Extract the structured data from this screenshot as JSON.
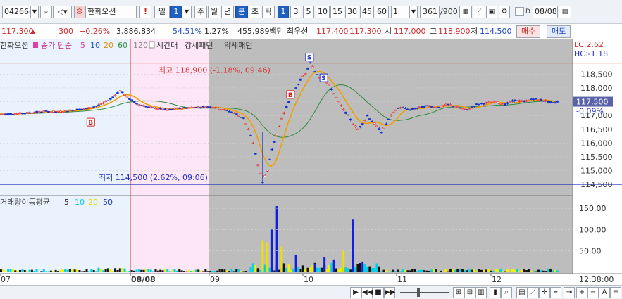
{
  "toolbar": {
    "code": "042660",
    "name": "한화오션",
    "badge": "증",
    "alert": "!",
    "period_day": "일",
    "period_count": "1",
    "periods": [
      "주",
      "월",
      "년",
      "분",
      "초",
      "틱"
    ],
    "minute_steps": [
      "1",
      "3",
      "5",
      "10",
      "15",
      "30",
      "45",
      "60"
    ],
    "count_value": "1",
    "range_value": "361",
    "range_total": "/900",
    "date_flag": "D",
    "date_value": "08/08"
  },
  "info": {
    "price": "117,300",
    "change": "300",
    "change_pct": "+0.26%",
    "volume": "3,886,834",
    "ratio": "54.51%",
    "rate": "1.27%",
    "amount": "455,989백만",
    "ask_label": "최우선",
    "ask": "117,400",
    "bid": "117,300",
    "open_label": "시",
    "open": "117,000",
    "high_label": "고",
    "high": "118,900",
    "low_label": "저",
    "low": "114,500",
    "buy": "매수",
    "sell": "매도"
  },
  "chart_labels": {
    "legend_name": "한화오션",
    "legend_type": "종가 단순",
    "ma": [
      "5",
      "10",
      "20",
      "60",
      "120"
    ],
    "pattern_time": "시간대",
    "pattern_strong": "강세패턴",
    "pattern_weak": "약세패턴",
    "high_marker": "최고 118,900 (-1.18%, 09:46)",
    "low_marker": "최저 114,500 (2.62%, 09:06)",
    "lc": "LC:2.62",
    "hc": "HC:-1.18",
    "current_price": "117,500",
    "current_pct": "-0.09%",
    "volume_legend": "거래량이동평균",
    "volume_ma": [
      "5",
      "10",
      "20",
      "50"
    ],
    "signal_s": "S",
    "signal_b": "B",
    "time_right": "12:38:00"
  },
  "chart_data": {
    "type": "candlestick",
    "price_axis": {
      "ticks": [
        118500,
        118000,
        117500,
        117000,
        116500,
        116000,
        115500,
        115000,
        114500
      ],
      "range": [
        114300,
        119300
      ]
    },
    "volume_axis": {
      "ticks": [
        "150,00",
        "100,00",
        "50,00"
      ],
      "range": [
        0,
        170
      ]
    },
    "x_ticks": [
      "07",
      "08/08",
      "09",
      "10",
      "11",
      "12"
    ],
    "high_line": 118900,
    "low_line": 114500,
    "current": 117500,
    "price_path": [
      [
        0,
        117050
      ],
      [
        3,
        117070
      ],
      [
        6,
        117100
      ],
      [
        9,
        117150
      ],
      [
        12,
        117130
      ],
      [
        15,
        117200
      ],
      [
        18,
        117250
      ],
      [
        21,
        117400
      ],
      [
        23,
        117600
      ],
      [
        25,
        117900
      ],
      [
        27,
        117600
      ],
      [
        29,
        117400
      ],
      [
        31,
        117300
      ],
      [
        33,
        117250
      ],
      [
        35,
        117200
      ],
      [
        37,
        117250
      ],
      [
        39,
        117280
      ],
      [
        41,
        117300
      ],
      [
        43,
        117320
      ],
      [
        45,
        117300
      ],
      [
        47,
        117200
      ],
      [
        49,
        117100
      ],
      [
        51,
        116900
      ],
      [
        52,
        116500
      ],
      [
        53,
        116000
      ],
      [
        54,
        115200
      ],
      [
        55,
        114600
      ],
      [
        56,
        115000
      ],
      [
        57,
        115800
      ],
      [
        58,
        116300
      ],
      [
        59,
        116900
      ],
      [
        60,
        117300
      ],
      [
        61,
        117700
      ],
      [
        62,
        118000
      ],
      [
        63,
        118300
      ],
      [
        64,
        118500
      ],
      [
        65,
        118900
      ],
      [
        66,
        118600
      ],
      [
        67,
        118400
      ],
      [
        68,
        118300
      ],
      [
        69,
        118100
      ],
      [
        70,
        117800
      ],
      [
        71,
        117500
      ],
      [
        72,
        117200
      ],
      [
        73,
        117000
      ],
      [
        74,
        116700
      ],
      [
        75,
        116500
      ],
      [
        76,
        116700
      ],
      [
        77,
        117000
      ],
      [
        78,
        116800
      ],
      [
        79,
        116600
      ],
      [
        80,
        116400
      ],
      [
        81,
        116700
      ],
      [
        82,
        117000
      ],
      [
        83,
        117200
      ],
      [
        84,
        117300
      ],
      [
        86,
        117200
      ],
      [
        88,
        117300
      ],
      [
        90,
        117350
      ],
      [
        92,
        117300
      ],
      [
        94,
        117400
      ],
      [
        96,
        117300
      ],
      [
        98,
        117200
      ],
      [
        100,
        117400
      ],
      [
        102,
        117450
      ],
      [
        104,
        117500
      ],
      [
        106,
        117400
      ],
      [
        108,
        117550
      ],
      [
        110,
        117500
      ],
      [
        112,
        117600
      ],
      [
        114,
        117550
      ],
      [
        116,
        117450
      ],
      [
        117,
        117500
      ]
    ],
    "volume_bars": [
      [
        55,
        75
      ],
      [
        56,
        70
      ],
      [
        57,
        100
      ],
      [
        58,
        155
      ],
      [
        59,
        60
      ],
      [
        62,
        40
      ],
      [
        66,
        20
      ],
      [
        70,
        30
      ],
      [
        74,
        125
      ],
      [
        76,
        25
      ],
      [
        72,
        50
      ],
      [
        68,
        35
      ]
    ],
    "signals": [
      {
        "type": "S",
        "x": 65,
        "price": 118900
      },
      {
        "type": "S",
        "x": 68,
        "price": 118150
      },
      {
        "type": "B",
        "x": 61,
        "price": 117950
      },
      {
        "type": "B",
        "x": 19,
        "price": 116950
      }
    ]
  }
}
